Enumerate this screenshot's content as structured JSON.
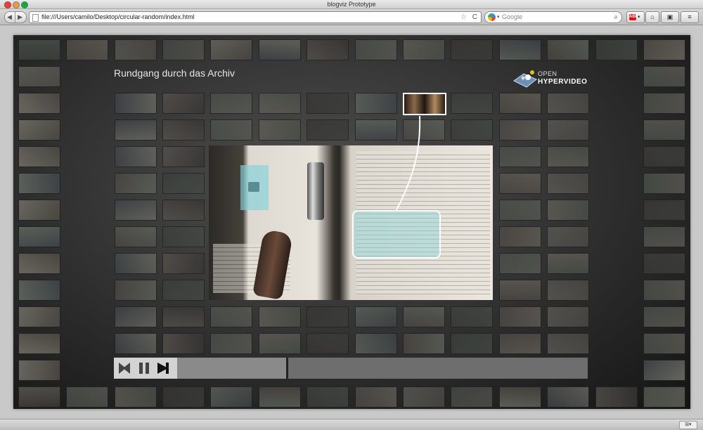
{
  "window": {
    "title": "blogviz Prototype"
  },
  "browser": {
    "url": "file:///Users/camilo/Desktop/circular-random/index.html",
    "search_placeholder": "Google",
    "nav_back": "◀",
    "nav_forward": "▶",
    "star_icon": "☆",
    "reload_icon": "C",
    "search_icon": "⌕",
    "adblock_label": "ABP",
    "home_icon": "⌂",
    "screenshot_icon": "▣",
    "menu_icon": "≡"
  },
  "page": {
    "heading": "Rundgang durch das Archiv",
    "logo_open": "OPEN",
    "logo_hypervideo": "HYPERVIDEO"
  },
  "thumbnail_tones": [
    "#3c3e3a",
    "#4d4a45",
    "#5a5a55",
    "#444a45",
    "#6a6a62",
    "#3e4346",
    "#55524c",
    "#4a5048",
    "#625e58",
    "#383634",
    "#5e635c",
    "#4b4742"
  ],
  "colors": {
    "stage_dark": "#141414",
    "highlight": "#8cd7dc",
    "accent_white": "#ffffff"
  }
}
